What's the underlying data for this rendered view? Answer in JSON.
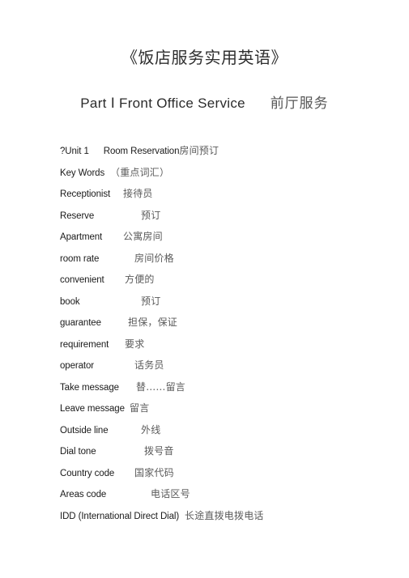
{
  "document": {
    "title": "《饭店服务实用英语》",
    "part_heading": {
      "english": "Part Ⅰ  Front Office Service",
      "chinese": "前厅服务"
    },
    "unit": {
      "marker": "?",
      "label": "Unit 1",
      "topic_en": "Room Reservation",
      "topic_zh": "房间预订"
    },
    "section": {
      "label_en": "Key Words",
      "label_zh": "（重点词汇）"
    },
    "vocabulary": [
      {
        "term": "Receptionist",
        "gloss": "接待员",
        "term_width": 72,
        "gap": 6
      },
      {
        "term": "Reserve",
        "gloss": "预订",
        "term_width": 72,
        "gap": 28
      },
      {
        "term": "Apartment",
        "gloss": "公寓房间",
        "term_width": 72,
        "gap": 6
      },
      {
        "term": "room rate",
        "gloss": "房间价格",
        "term_width": 72,
        "gap": 20
      },
      {
        "term": "convenient",
        "gloss": "方便的",
        "term_width": 72,
        "gap": 8
      },
      {
        "term": "book",
        "gloss": "预订",
        "term_width": 72,
        "gap": 28
      },
      {
        "term": "guarantee",
        "gloss": "担保，保证",
        "term_width": 72,
        "gap": 12
      },
      {
        "term": "requirement",
        "gloss": "要求",
        "term_width": 72,
        "gap": 8
      },
      {
        "term": "operator",
        "gloss": "话务员",
        "term_width": 72,
        "gap": 20
      },
      {
        "term": "Take message",
        "gloss": "替……留言",
        "term_width": 80,
        "gap": 14
      },
      {
        "term": "Leave message",
        "gloss": "留言",
        "term_width": 80,
        "gap": 6
      },
      {
        "term": "Outside line",
        "gloss": "外线",
        "term_width": 80,
        "gap": 20
      },
      {
        "term": "Dial tone",
        "gloss": "拨号音",
        "term_width": 80,
        "gap": 24
      },
      {
        "term": "Country code",
        "gloss": "国家代码",
        "term_width": 80,
        "gap": 12
      },
      {
        "term": "Areas code",
        "gloss": "电话区号",
        "term_width": 80,
        "gap": 32
      },
      {
        "term": "IDD  (International Direct Dial)",
        "gloss": "长途直拨电拨电话",
        "term_width": 148,
        "gap": 6
      }
    ]
  }
}
